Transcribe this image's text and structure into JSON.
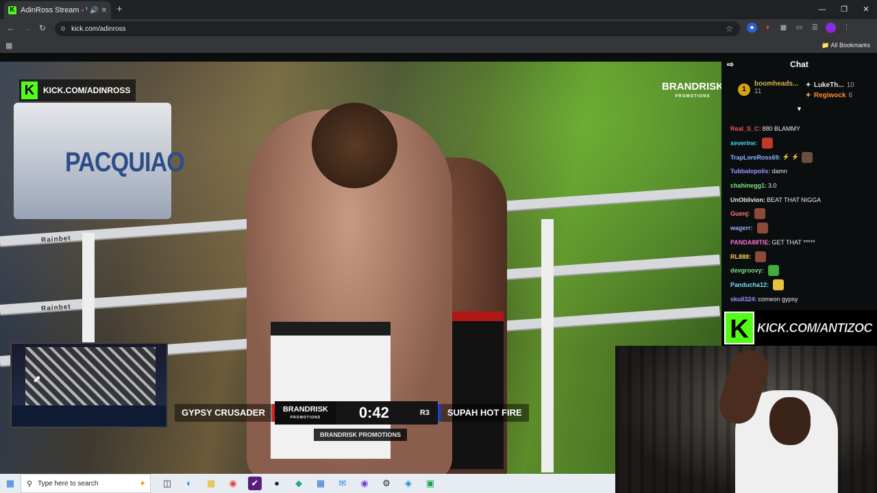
{
  "browser": {
    "tab_title": "AdinRoss Stream - Watch Li",
    "tab_favicon": "K",
    "new_tab": "+",
    "address": "kick.com/adinross",
    "bookmarks_label": "All Bookmarks"
  },
  "stream": {
    "kick_badge_letter": "K",
    "kick_badge_url": "KICK.COM/ADINROSS",
    "brand_top": "BRANDRISK",
    "brand_top_sub": "PROMOTIONS",
    "banner_text": "PACQUIAO",
    "rope_sponsor": "Rainbet",
    "scoreboard": {
      "fighter_left": "GYPSY CRUSADER",
      "brand": "BRANDRISK",
      "brand_sub": "PROMOTIONS",
      "clock": "0:42",
      "round": "R3",
      "fighter_right": "SUPAH HOT FIRE"
    },
    "sub_banner": "BRANDRISK PROMOTIONS"
  },
  "chat": {
    "title": "Chat",
    "pinned": {
      "rank": "1",
      "top_user": "boomheads...",
      "top_count": "11",
      "second_user": "LukeTh...",
      "second_count": "10",
      "third_user": "Regiwock",
      "third_count": "6"
    },
    "messages": [
      {
        "user": "Real_S_C:",
        "text": "880 BLAMMY",
        "color": "#e85a5a"
      },
      {
        "user": "xeverine:",
        "text": "",
        "color": "#4fd1e8",
        "emote": "#c0392b"
      },
      {
        "user": "TrapLoreRoss69:",
        "text": "⚡ ⚡",
        "color": "#8fb4ff",
        "emote": "#6b4f3a"
      },
      {
        "user": "Tubbalopolis:",
        "text": "damn",
        "color": "#a88bff"
      },
      {
        "user": "chahinegg1:",
        "text": "3.0",
        "color": "#7ee07e"
      },
      {
        "user": "UnOblivion:",
        "text": "BEAT THAT NIGGA",
        "color": "#e8e8e8"
      },
      {
        "user": "Guenj:",
        "text": "",
        "color": "#ff7a7a",
        "emote": "#8b4a3a"
      },
      {
        "user": "wagerr:",
        "text": "",
        "color": "#8fb4ff",
        "emote": "#8b4a3a"
      },
      {
        "user": "PANDA88TIE:",
        "text": "GET THAT *****",
        "color": "#ff6fd1"
      },
      {
        "user": "RL888:",
        "text": "",
        "color": "#ffd24a",
        "emote": "#8b4a3a"
      },
      {
        "user": "devgroovy:",
        "text": "",
        "color": "#7ee07e",
        "emote": "#3fae3f"
      },
      {
        "user": "Panducha12:",
        "text": "",
        "color": "#6fe0ff",
        "emote": "#e8c040"
      },
      {
        "user": "skull324:",
        "text": "comeon gypsy",
        "color": "#a88bff"
      }
    ]
  },
  "overlay": {
    "kick_letter": "K",
    "kick_url": "KICK.COM/ANTIZOC"
  },
  "taskbar": {
    "search_placeholder": "Type here to search"
  }
}
